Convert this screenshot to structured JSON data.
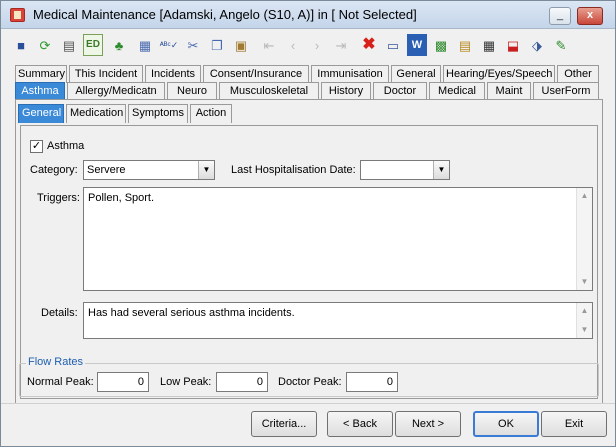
{
  "window": {
    "title": "Medical Maintenance   [Adamski, Angelo (S10, A)] in [ Not Selected]",
    "minimize_label": "_",
    "maximize_label": "□",
    "close_label": "x"
  },
  "toolbar": {
    "ed_label": "ED",
    "icons": [
      "save-icon",
      "refresh-icon",
      "print-icon",
      "edit-icon",
      "tree-icon",
      "calculator-icon",
      "spellcheck-icon",
      "cut-icon",
      "copy-icon",
      "paste-icon",
      "first-icon",
      "prev-icon",
      "next-icon",
      "last-icon",
      "delete-icon",
      "card-icon",
      "word-icon",
      "grid-icon",
      "note-icon",
      "film-icon",
      "pin-icon",
      "tag-icon",
      "edit-note-icon"
    ]
  },
  "tabs_row1": [
    "Summary",
    "This Incident",
    "Incidents",
    "Consent/Insurance",
    "Immunisation",
    "General",
    "Hearing/Eyes/Speech",
    "Other"
  ],
  "tabs_row2": [
    "Asthma",
    "Allergy/Medicatn",
    "Neuro",
    "Musculoskeletal",
    "History",
    "Doctor",
    "Medical",
    "Maint",
    "UserForm"
  ],
  "subtabs": [
    "General",
    "Medication",
    "Symptoms",
    "Action"
  ],
  "form": {
    "asthma_label": "Asthma",
    "asthma_checked": "✓",
    "category_label": "Category:",
    "category_value": "Servere",
    "last_hosp_label": "Last Hospitalisation Date:",
    "last_hosp_value": "",
    "triggers_label": "Triggers:",
    "triggers_value": "Pollen, Sport.",
    "details_label": "Details:",
    "details_value": "Has had several serious asthma incidents."
  },
  "flow_rates": {
    "title": "Flow Rates",
    "normal_label": "Normal Peak:",
    "normal_value": "0",
    "low_label": "Low Peak:",
    "low_value": "0",
    "doctor_label": "Doctor Peak:",
    "doctor_value": "0"
  },
  "buttons": {
    "criteria": "Criteria...",
    "back": "< Back",
    "next": "Next >",
    "ok": "OK",
    "exit": "Exit"
  },
  "colors": {
    "active_tab": "#3a8ad8"
  }
}
